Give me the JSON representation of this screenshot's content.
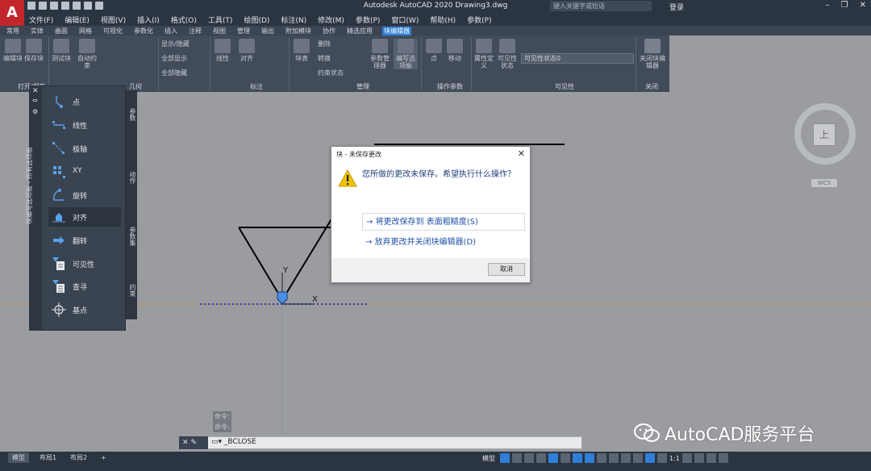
{
  "app": {
    "logo": "A",
    "title": "Autodesk AutoCAD 2020    Drawing3.dwg",
    "search_placeholder": "键入关键字或短语",
    "login": "登录"
  },
  "menu": [
    "文件(F)",
    "编辑(E)",
    "视图(V)",
    "插入(I)",
    "格式(O)",
    "工具(T)",
    "绘图(D)",
    "标注(N)",
    "修改(M)",
    "参数(P)",
    "窗口(W)",
    "帮助(H)",
    "参数(P)"
  ],
  "ribbon_tabs": [
    "常用",
    "实体",
    "曲面",
    "网格",
    "可视化",
    "参数化",
    "插入",
    "注释",
    "视图",
    "管理",
    "输出",
    "附加模块",
    "协作",
    "精选应用",
    "块编辑器"
  ],
  "ribbon_active_tab": "块编辑器",
  "ribbon": {
    "buttons": [
      "编辑块",
      "保存块",
      "测试块",
      "自动约束",
      "线性",
      "对齐",
      "块表",
      "参数管理器",
      "编写选项板",
      "点",
      "移动",
      "属性定义",
      "可见性状态",
      "关闭块编辑器"
    ],
    "small": [
      "显示/隐藏",
      "全部显示",
      "全部隐藏",
      "删除",
      "转换",
      "约束状态"
    ],
    "groups": [
      "打开/保存",
      "几何",
      "标注",
      "管理",
      "操作参数",
      "可见性",
      "关闭"
    ],
    "visibility_state": "可见性状态0"
  },
  "palette": {
    "title": "块编写选项板 - 所有选项板",
    "tabs": [
      "参数",
      "动作",
      "参数集",
      "约束"
    ],
    "items": [
      "点",
      "线性",
      "极轴",
      "XY",
      "旋转",
      "对齐",
      "翻转",
      "可见性",
      "查寻",
      "基点"
    ],
    "selected": "对齐"
  },
  "viewcube": {
    "face": "上",
    "wcs": "WCS"
  },
  "dialog": {
    "title": "块 - 未保存更改",
    "message": "您所做的更改未保存。希望执行什么操作？",
    "option1": "将更改保存到 表面粗糙度(S)",
    "option2": "放弃更改并关闭块编辑器(D)",
    "cancel": "取消"
  },
  "drawing": {
    "axis_y": "Y",
    "axis_x": "X"
  },
  "command": {
    "history": [
      "命令:",
      "命令:"
    ],
    "current": "_BCLOSE"
  },
  "watermark": "AutoCAD服务平台",
  "layouts": [
    "模型",
    "布局1",
    "布局2",
    "+"
  ],
  "status": {
    "model": "模型",
    "scale": "1:1"
  }
}
